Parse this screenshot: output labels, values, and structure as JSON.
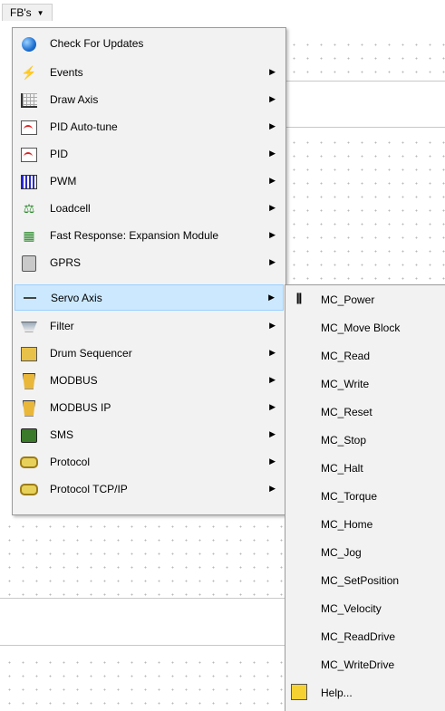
{
  "menubar": {
    "label": "FB's"
  },
  "menu": {
    "items": [
      {
        "label": "Check For Updates",
        "icon": "globe-icon",
        "submenu": false
      },
      {
        "label": "Events",
        "icon": "events-icon",
        "submenu": true
      },
      {
        "label": "Draw Axis",
        "icon": "draw-axis-icon",
        "submenu": true
      },
      {
        "label": "PID Auto-tune",
        "icon": "pid-autotune-icon",
        "submenu": true
      },
      {
        "label": "PID",
        "icon": "pid-icon",
        "submenu": true
      },
      {
        "label": "PWM",
        "icon": "pwm-icon",
        "submenu": true
      },
      {
        "label": "Loadcell",
        "icon": "loadcell-icon",
        "submenu": true
      },
      {
        "label": "Fast Response: Expansion Module",
        "icon": "expansion-module-icon",
        "submenu": true
      },
      {
        "label": "GPRS",
        "icon": "gprs-icon",
        "submenu": true
      },
      {
        "label": "Servo Axis",
        "icon": "servo-axis-icon",
        "submenu": true,
        "highlighted": true
      },
      {
        "label": "Filter",
        "icon": "filter-icon",
        "submenu": true
      },
      {
        "label": "Drum Sequencer",
        "icon": "drum-sequencer-icon",
        "submenu": true
      },
      {
        "label": "MODBUS",
        "icon": "modbus-icon",
        "submenu": true
      },
      {
        "label": "MODBUS IP",
        "icon": "modbus-ip-icon",
        "submenu": true
      },
      {
        "label": "SMS",
        "icon": "sms-icon",
        "submenu": true
      },
      {
        "label": "Protocol",
        "icon": "protocol-icon",
        "submenu": true
      },
      {
        "label": "Protocol TCP/IP",
        "icon": "protocol-tcpip-icon",
        "submenu": true
      }
    ]
  },
  "submenu": {
    "items": [
      {
        "label": "MC_Power"
      },
      {
        "label": "MC_Move Block"
      },
      {
        "label": "MC_Read"
      },
      {
        "label": "MC_Write"
      },
      {
        "label": "MC_Reset"
      },
      {
        "label": "MC_Stop"
      },
      {
        "label": "MC_Halt"
      },
      {
        "label": "MC_Torque"
      },
      {
        "label": "MC_Home"
      },
      {
        "label": "MC_Jog"
      },
      {
        "label": "MC_SetPosition"
      },
      {
        "label": "MC_Velocity"
      },
      {
        "label": "MC_ReadDrive"
      },
      {
        "label": "MC_WriteDrive"
      },
      {
        "label": "Help..."
      }
    ]
  },
  "colors": {
    "highlight": "#cce8ff",
    "highlight_border": "#99d1ff",
    "menu_bg": "#f2f2f2"
  }
}
